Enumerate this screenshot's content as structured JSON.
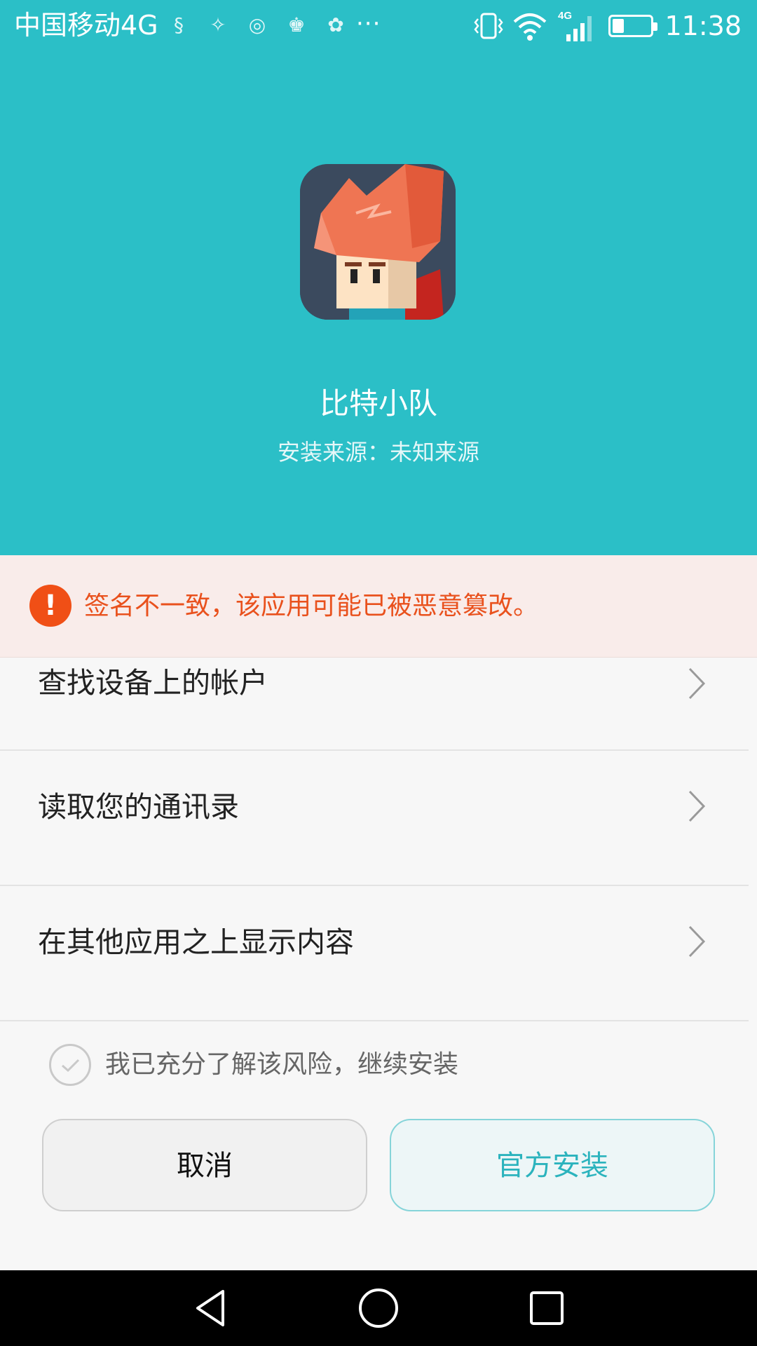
{
  "status_bar": {
    "carrier": "中国移动4G",
    "network_badge": "4G",
    "time": "11:38",
    "more_indicator": "···",
    "battery_level": 0.3,
    "icons": [
      "notification-icon-1",
      "notification-icon-2",
      "notification-icon-3",
      "notification-icon-4",
      "notification-icon-5",
      "vibrate-icon",
      "wifi-icon",
      "signal-icon",
      "battery-icon"
    ]
  },
  "app": {
    "name": "比特小队",
    "source": "安装来源：未知来源"
  },
  "warning": {
    "icon_glyph": "!",
    "text": "签名不一致，该应用可能已被恶意篡改。",
    "color": "#e9511d"
  },
  "permissions": [
    {
      "label": "查找设备上的帐户"
    },
    {
      "label": "读取您的通讯录"
    },
    {
      "label": "在其他应用之上显示内容"
    }
  ],
  "confirm": {
    "label": "我已充分了解该风险，继续安装",
    "checked": false
  },
  "buttons": {
    "cancel": "取消",
    "install": "官方安装"
  },
  "colors": {
    "header_bg": "#2bbfc7",
    "warning_bg": "#f9ecea",
    "accent": "#2bb3bd"
  },
  "navigation": [
    "back-icon",
    "home-icon",
    "recents-icon"
  ]
}
